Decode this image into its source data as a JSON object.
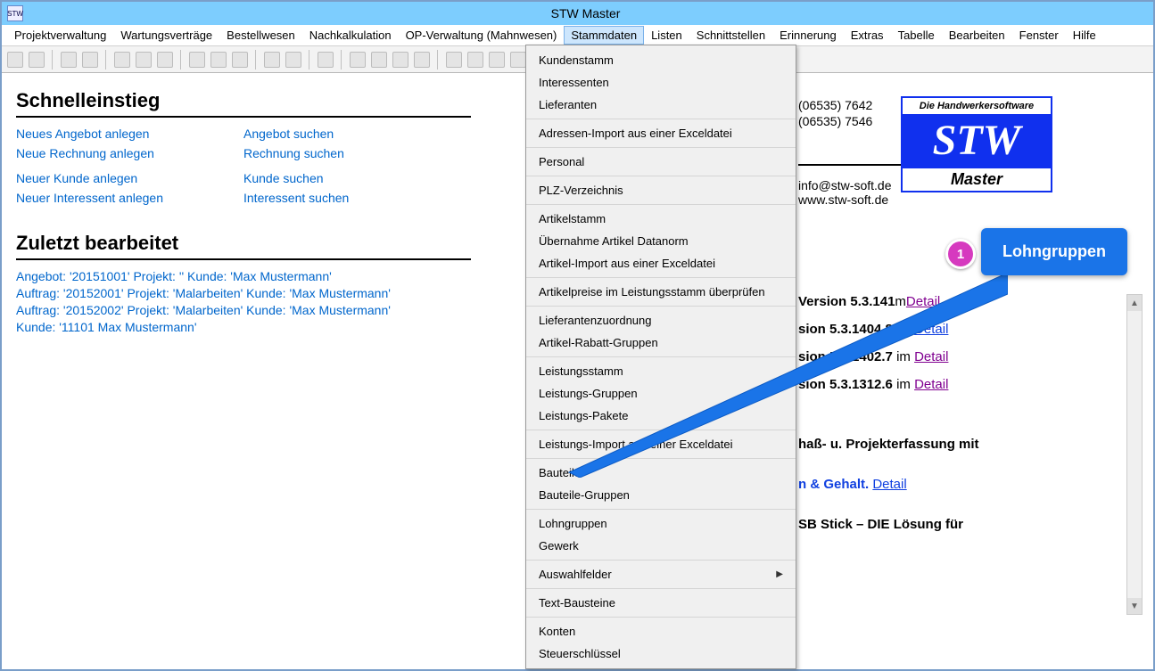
{
  "app": {
    "title": "STW Master",
    "icon": "STW"
  },
  "menubar": [
    "Projektverwaltung",
    "Wartungsverträge",
    "Bestellwesen",
    "Nachkalkulation",
    "OP-Verwaltung (Mahnwesen)",
    "Stammdaten",
    "Listen",
    "Schnittstellen",
    "Erinnerung",
    "Extras",
    "Tabelle",
    "Bearbeiten",
    "Fenster",
    "Hilfe"
  ],
  "activeMenuIndex": 5,
  "dropdown": {
    "groups": [
      [
        "Kundenstamm",
        "Interessenten",
        "Lieferanten"
      ],
      [
        "Adressen-Import aus einer Exceldatei"
      ],
      [
        "Personal"
      ],
      [
        "PLZ-Verzeichnis"
      ],
      [
        "Artikelstamm",
        "Übernahme Artikel Datanorm",
        "Artikel-Import aus einer Exceldatei"
      ],
      [
        "Artikelpreise im Leistungsstamm überprüfen"
      ],
      [
        "Lieferantenzuordnung",
        "Artikel-Rabatt-Gruppen"
      ],
      [
        "Leistungsstamm",
        "Leistungs-Gruppen",
        "Leistungs-Pakete"
      ],
      [
        "Leistungs-Import aus einer Exceldatei"
      ],
      [
        "Bauteile",
        "Bauteile-Gruppen"
      ],
      [
        "Lohngruppen",
        "Gewerk"
      ],
      [
        "Auswahlfelder ▶"
      ],
      [
        "Text-Bausteine"
      ],
      [
        "Konten",
        "Steuerschlüssel"
      ]
    ]
  },
  "quick": {
    "title": "Schnelleinstieg",
    "links": [
      [
        "Neues Angebot anlegen",
        "Angebot suchen"
      ],
      [
        "Neue Rechnung anlegen",
        "Rechnung suchen"
      ],
      [
        "",
        ""
      ],
      [
        "Neuer Kunde anlegen",
        "Kunde suchen"
      ],
      [
        "Neuer Interessent anlegen",
        "Interessent suchen"
      ]
    ]
  },
  "recent": {
    "title": "Zuletzt bearbeitet",
    "items": [
      "Angebot: '20151001' Projekt: '' Kunde: 'Max Mustermann'",
      "Auftrag: '20152001' Projekt: 'Malarbeiten' Kunde: 'Max Mustermann'",
      "Auftrag: '20152002' Projekt: 'Malarbeiten' Kunde: 'Max Mustermann'",
      "Kunde: '11101 Max Mustermann'"
    ]
  },
  "info": {
    "phone1": "(06535) 7642",
    "phone2": "(06535) 7546",
    "email": "info@stw-soft.de",
    "web": "www.stw-soft.de"
  },
  "logo": {
    "tag": "Die Handwerkersoftware",
    "brand": "STW",
    "sub": "Master"
  },
  "versions": [
    {
      "prefix": "Version 5.3.141",
      "suffix": "m",
      "link": "Detail",
      "class": "purple-link"
    },
    {
      "prefix": "sion 5.3.1404.8",
      "suffix": " im ",
      "link": "Detail",
      "class": ""
    },
    {
      "prefix": "sion 5.3.1402.7",
      "suffix": " im ",
      "link": "Detail",
      "class": "purple-link"
    },
    {
      "prefix": "sion 5.3.1312.6",
      "suffix": " im ",
      "link": "Detail",
      "class": "purple-link"
    }
  ],
  "misc": [
    {
      "text": "haß- u. Projekterfassung mit",
      "link": ""
    },
    {
      "text": "n & Gehalt. ",
      "link": "Detail",
      "textcolor": "#1040e0"
    },
    {
      "text": "SB Stick – DIE Lösung für",
      "link": ""
    }
  ],
  "callout": {
    "num": "1",
    "label": "Lohngruppen"
  }
}
